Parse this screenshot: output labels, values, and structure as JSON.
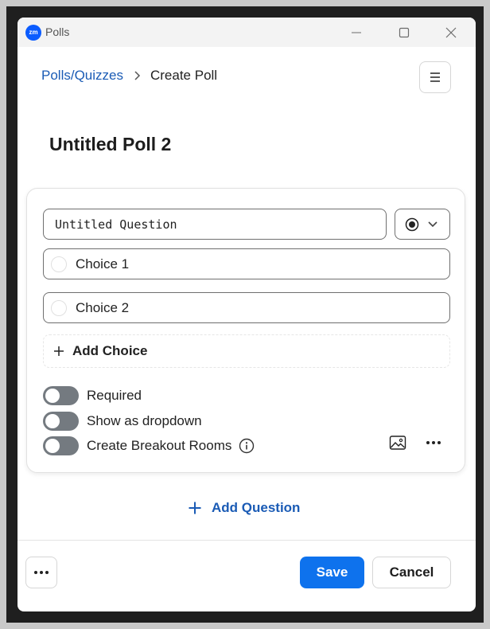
{
  "window": {
    "app_logo_text": "zm",
    "title": "Polls"
  },
  "breadcrumb": {
    "parent": "Polls/Quizzes",
    "current": "Create Poll"
  },
  "poll": {
    "title": "Untitled Poll 2"
  },
  "question": {
    "value": "Untitled Question",
    "type": "single-choice",
    "choices": [
      {
        "label": "Choice 1"
      },
      {
        "label": "Choice 2"
      }
    ],
    "add_choice_label": "Add Choice",
    "toggles": [
      {
        "label": "Required",
        "on": false
      },
      {
        "label": "Show as dropdown",
        "on": false
      },
      {
        "label": "Create Breakout Rooms",
        "on": false
      }
    ]
  },
  "add_question_label": "Add Question",
  "footer": {
    "save_label": "Save",
    "cancel_label": "Cancel"
  },
  "colors": {
    "brand": "#0b5cff",
    "link": "#1a5bb5",
    "primary_button": "#0e72ed",
    "toggle_off": "#747a80"
  },
  "icons": [
    "zoom-logo-icon",
    "minimize-icon",
    "maximize-icon",
    "close-icon",
    "chevron-right-icon",
    "hamburger-menu-icon",
    "radio-selected-icon",
    "chevron-down-icon",
    "plus-icon",
    "info-icon",
    "image-icon",
    "more-horizontal-icon"
  ]
}
